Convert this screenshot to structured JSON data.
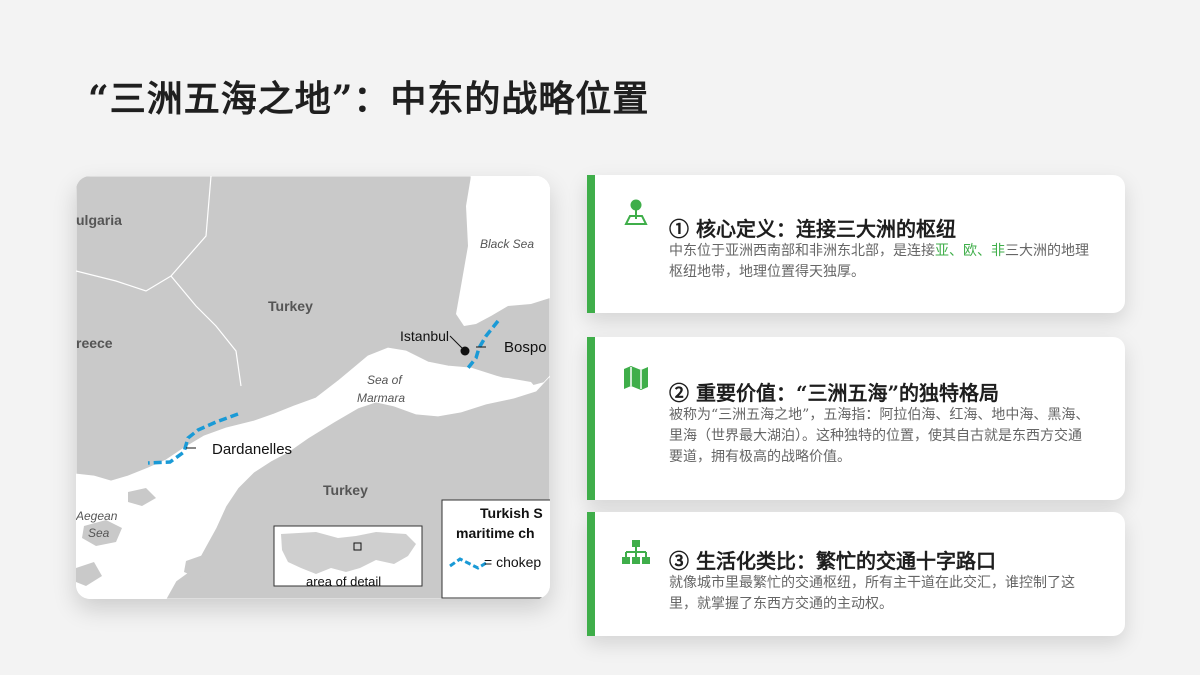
{
  "title": "“三洲五海之地”：中东的战略位置",
  "map": {
    "labels": {
      "bulgaria": "ulgaria",
      "greece": "reece",
      "turkey_north": "Turkey",
      "turkey_south": "Turkey",
      "black_sea": "Black Sea",
      "istanbul": "Istanbul",
      "bosporus": "Bospo",
      "sea_of_marmara_1": "Sea of",
      "sea_of_marmara_2": "Marmara",
      "dardanelles": "Dardanelles",
      "aegean_1": "Aegean",
      "aegean_2": "Sea"
    },
    "inset_label": "area of detail",
    "legend": {
      "title_line1": "Turkish S",
      "title_line2": "maritime ch",
      "item": "= chokep"
    },
    "colors": {
      "land": "#c9c9c9",
      "sea": "#ffffff",
      "chokepoint": "#1a9ad6"
    }
  },
  "cards": [
    {
      "icon": "map-pin-icon",
      "heading": "① 核心定义：连接三大洲的枢纽",
      "body_prefix": "中东位于亚洲西南部和非洲东北部，是连接",
      "body_highlight": "亚、欧、非",
      "body_suffix": "三大洲的地理枢纽地带，地理位置得天独厚。"
    },
    {
      "icon": "folded-map-icon",
      "heading": "② 重要价值：“三洲五海”的独特格局",
      "body": "被称为“三洲五海之地”，五海指：阿拉伯海、红海、地中海、黑海、里海（世界最大湖泊）。这种独特的位置，使其自古就是东西方交通要道，拥有极高的战略价值。"
    },
    {
      "icon": "network-hierarchy-icon",
      "heading": "③ 生活化类比：繁忙的交通十字路口",
      "body": "就像城市里最繁忙的交通枢纽，所有主干道在此交汇，谁控制了这里，就掌握了东西方交通的主动权。"
    }
  ],
  "accent_color": "#3fae4a"
}
